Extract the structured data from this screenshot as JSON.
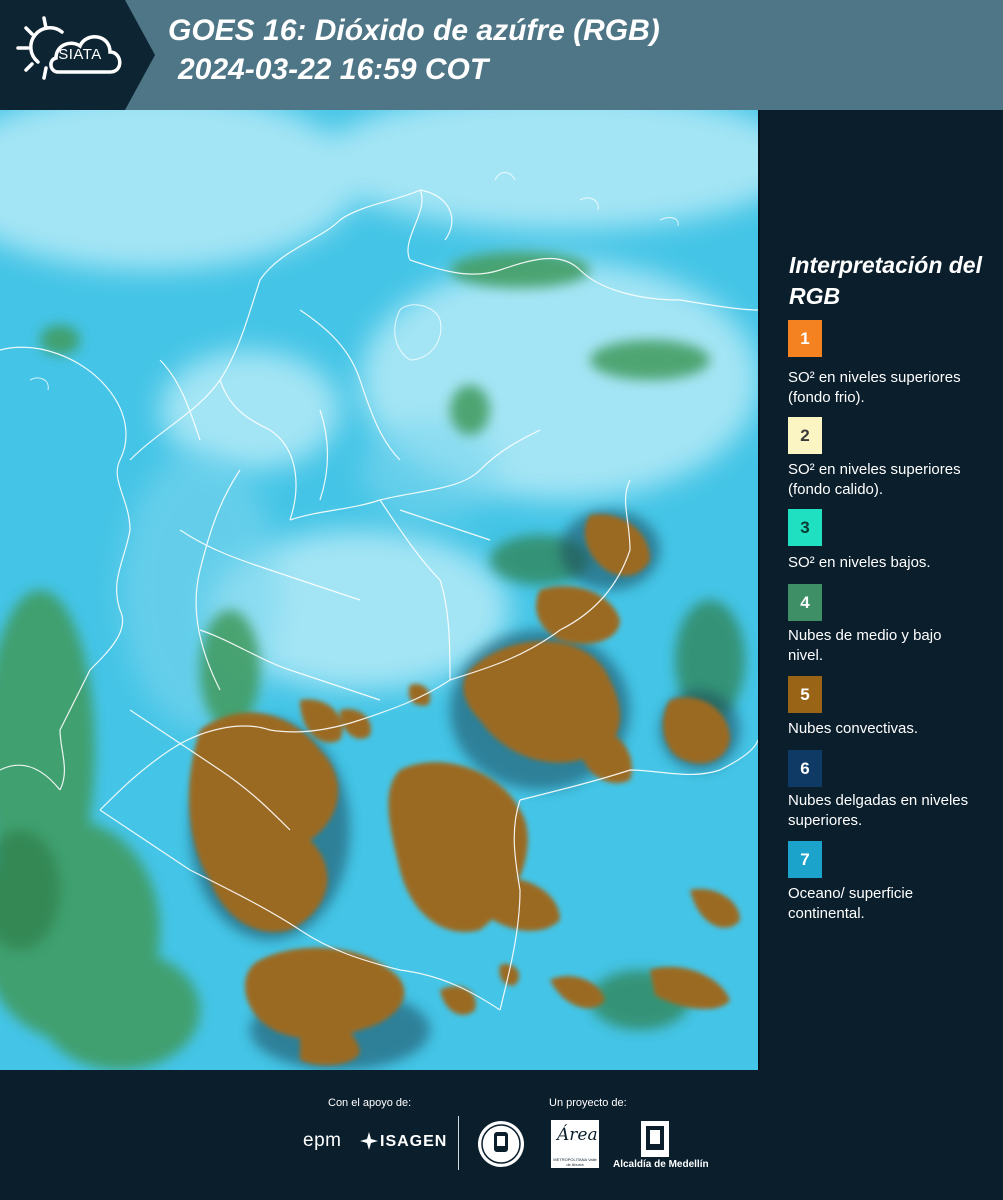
{
  "header": {
    "logo_text": "SIATA",
    "title_line1": "GOES 16: Dióxido de azúfre (RGB)",
    "title_line2": "2024-03-22 16:59 COT"
  },
  "map": {
    "icon": "satellite-image",
    "colors": {
      "ocean": "#44c4e6",
      "cloud_high": "#b2eaf8",
      "convective": "#9b6a22",
      "low_cloud": "#3c9a5a",
      "borders": "#ffffff"
    }
  },
  "legend": {
    "title": "Interpretación del RGB",
    "items": [
      {
        "num": "1",
        "color": "#f58220",
        "text_color": "#ffffff",
        "label": "SO² en niveles superiores (fondo frio)."
      },
      {
        "num": "2",
        "color": "#fbf5c3",
        "text_color": "#3a3a3a",
        "label": "SO² en niveles superiores (fondo calido)."
      },
      {
        "num": "3",
        "color": "#1fe0c0",
        "text_color": "#0a3a34",
        "label": "SO² en niveles bajos."
      },
      {
        "num": "4",
        "color": "#3e8f65",
        "text_color": "#ffffff",
        "label": "Nubes de medio y bajo nivel."
      },
      {
        "num": "5",
        "color": "#9a6417",
        "text_color": "#ffffff",
        "label": "Nubes convectivas."
      },
      {
        "num": "6",
        "color": "#0f3a66",
        "text_color": "#ffffff",
        "label": "Nubes delgadas en niveles superiores."
      },
      {
        "num": "7",
        "color": "#1ba3cc",
        "text_color": "#ffffff",
        "label": "Oceano/ superficie continental."
      }
    ]
  },
  "footer": {
    "support_label": "Con el apoyo de:",
    "project_label": "Un proyecto de:",
    "epm": "epm",
    "isagen": "ISAGEN",
    "area_script": "Área",
    "area_sub": "METROPOLITANA Valle de Aburrá",
    "alcaldia": "Alcaldía de Medellín"
  }
}
